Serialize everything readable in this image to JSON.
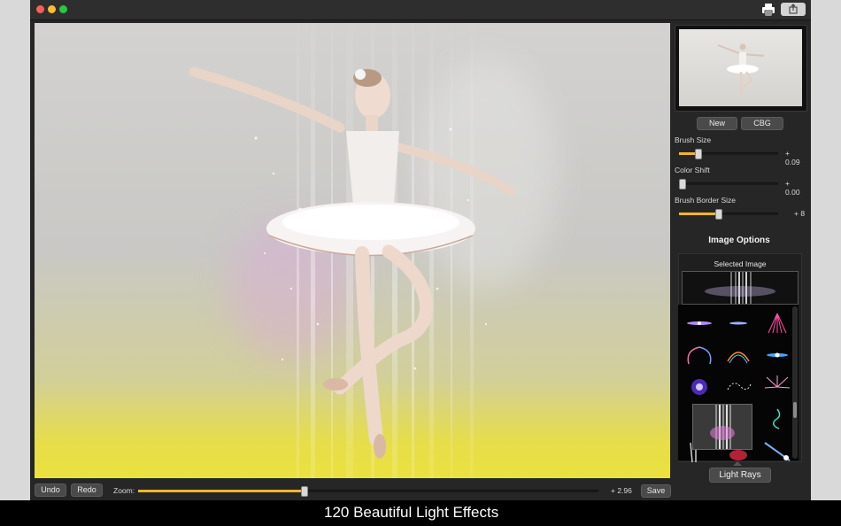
{
  "toolbar": {
    "print_icon": "printer-icon",
    "share_icon": "share-icon"
  },
  "bottom_bar": {
    "undo_label": "Undo",
    "redo_label": "Redo",
    "zoom_label": "Zoom:",
    "zoom_value": "+ 2.96",
    "zoom_fraction": 0.36,
    "save_label": "Save"
  },
  "sidebar": {
    "new_label": "New",
    "cbg_label": "CBG",
    "sliders": [
      {
        "label": "Brush Size",
        "value": "+ 0.09",
        "fraction": 0.19
      },
      {
        "label": "Color Shift",
        "value": "+ 0.00",
        "fraction": 0.0
      },
      {
        "label": "Brush Border Size",
        "value": "+ 8",
        "fraction": 0.39
      }
    ],
    "image_options_title": "Image Options",
    "selected_image_label": "Selected Image",
    "category_label": "Light Rays"
  },
  "caption": "120 Beautiful Light Effects",
  "colors": {
    "accent": "#f0b62b",
    "close": "#ff5f57",
    "minimize": "#febc2e",
    "zoom": "#28c840"
  }
}
